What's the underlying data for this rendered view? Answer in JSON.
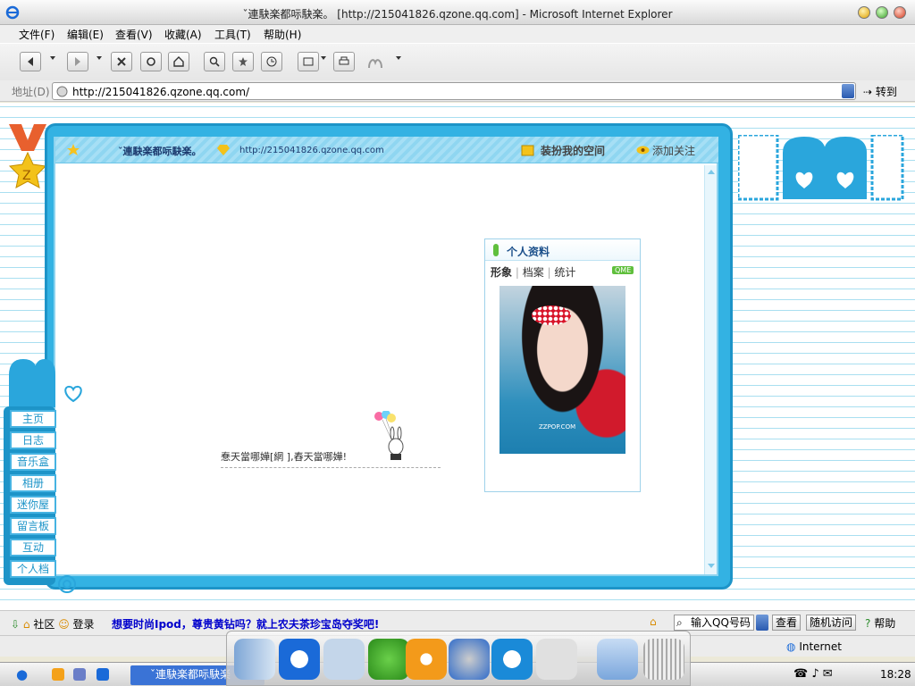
{
  "window": {
    "title": "ˇ連駃楽都呩駃楽。 [http://215041826.qzone.qq.com] - Microsoft Internet Explorer"
  },
  "menu": [
    "文件(F)",
    "编辑(E)",
    "查看(V)",
    "收藏(A)",
    "工具(T)",
    "帮助(H)"
  ],
  "address": {
    "label": "地址(D)",
    "url": "http://215041826.qzone.qq.com/",
    "go_label": "转到"
  },
  "qzone": {
    "title": "ˇ連駃楽都呩駃楽。",
    "url": "http://215041826.qzone.qq.com",
    "dress_link": "装扮我的空间",
    "follow_link": "添加关注",
    "status_text": "惷天當哪嬅[網 ],舂天當哪嬅!",
    "profile": {
      "title": "个人资料",
      "tabs": [
        "形象",
        "档案",
        "统计"
      ],
      "badge": "QME",
      "photo_caption": "ZZPOP.COM"
    },
    "nav": [
      "主页",
      "日志",
      "音乐盒",
      "相册",
      "迷你屋",
      "留言板",
      "互动",
      "个人档"
    ]
  },
  "statusbar": {
    "community": "社区",
    "login": "登录",
    "promo": "想要时尚Ipod，尊贵黄钻吗？就上农夫茶珍宝岛夺奖吧!",
    "qq_input": "输入QQ号码",
    "view_btn": "查看",
    "random_btn": "随机访问",
    "help_btn": "帮助"
  },
  "ie_status": {
    "zone": "Internet"
  },
  "taskbar": {
    "task_label": "ˇ連駃楽都呩駃楽",
    "time": "18:28"
  }
}
